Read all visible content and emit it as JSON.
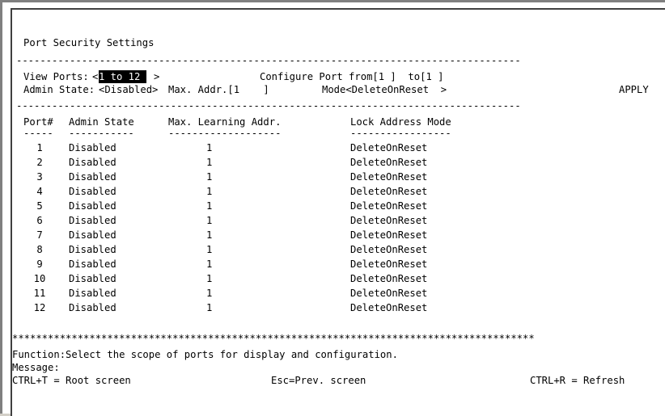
{
  "title": "Port Security Settings",
  "dash_line": "-------------------------------------------------------------------------------------",
  "star_line": "****************************************************************************************",
  "controls": {
    "view_ports_label": "View Ports:",
    "view_ports_open": "<",
    "view_ports_value": "1 to 12 ",
    "view_ports_close": ">",
    "configure_label": "Configure Port from[1 ]  to[1 ]",
    "admin_state_label": "Admin State:",
    "admin_state_value": "<Disabled>",
    "max_addr_label": "Max. Addr.[1    ]",
    "mode_label": "Mode<DeleteOnReset  >",
    "apply_label": "APPLY"
  },
  "table": {
    "headers": [
      "Port#",
      "Admin State",
      "Max. Learning Addr.",
      "Lock Address Mode"
    ],
    "underlines": [
      "-----",
      "-----------",
      "-------------------",
      "-----------------"
    ],
    "rows": [
      [
        "1",
        "Disabled",
        "1",
        "DeleteOnReset"
      ],
      [
        "2",
        "Disabled",
        "1",
        "DeleteOnReset"
      ],
      [
        "3",
        "Disabled",
        "1",
        "DeleteOnReset"
      ],
      [
        "4",
        "Disabled",
        "1",
        "DeleteOnReset"
      ],
      [
        "5",
        "Disabled",
        "1",
        "DeleteOnReset"
      ],
      [
        "6",
        "Disabled",
        "1",
        "DeleteOnReset"
      ],
      [
        "7",
        "Disabled",
        "1",
        "DeleteOnReset"
      ],
      [
        "8",
        "Disabled",
        "1",
        "DeleteOnReset"
      ],
      [
        "9",
        "Disabled",
        "1",
        "DeleteOnReset"
      ],
      [
        "10",
        "Disabled",
        "1",
        "DeleteOnReset"
      ],
      [
        "11",
        "Disabled",
        "1",
        "DeleteOnReset"
      ],
      [
        "12",
        "Disabled",
        "1",
        "DeleteOnReset"
      ]
    ]
  },
  "footer": {
    "function_text": "Function:Select the scope of ports for display and configuration.",
    "message_text": "Message:",
    "root_hint": "CTRL+T = Root screen",
    "prev_hint": "Esc=Prev. screen",
    "refresh_hint": "CTRL+R = Refresh"
  }
}
